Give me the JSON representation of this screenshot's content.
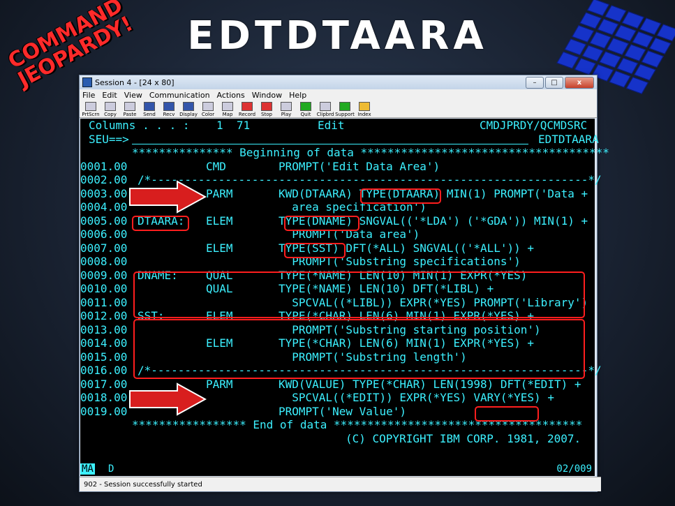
{
  "slide": {
    "title": "EDTDTAARA",
    "logo_left": "COMMAND JEOPARDY!"
  },
  "window": {
    "title": "Session 4 - [24 x 80]",
    "controls": [
      "–",
      "□",
      "x"
    ],
    "menu": [
      "File",
      "Edit",
      "View",
      "Communication",
      "Actions",
      "Window",
      "Help"
    ],
    "toolbar": [
      "PrtScrn",
      "Copy",
      "Paste",
      "Send",
      "Recv",
      "Display",
      "Color",
      "Map",
      "Record",
      "Stop",
      "Play",
      "Quit",
      "Clipbrd",
      "Support",
      "Index"
    ],
    "status": "902 - Session successfully started"
  },
  "terminal": {
    "header1_left": "Columns . . . :    1  71",
    "header1_mid": "Edit",
    "header1_right": "CMDJPRDY/QCMDSRC",
    "header2_left": "SEU==>",
    "header2_right": "EDTDTAARA",
    "begin": "*************** Beginning of data *************************************",
    "lines": [
      {
        "seq": "0001.00",
        "label": "",
        "type": "CMD",
        "text": "PROMPT('Edit Data Area')"
      },
      {
        "seq": "0002.00",
        "label": "",
        "type": "",
        "text": "/*-----------------------------------------------------------------*/",
        "full": true
      },
      {
        "seq": "0003.00",
        "label": "",
        "type": "PARM",
        "text": "KWD(DTAARA) TYPE(DTAARA) MIN(1) PROMPT('Data +"
      },
      {
        "seq": "0004.00",
        "label": "",
        "type": "",
        "text": "  area specification')"
      },
      {
        "seq": "0005.00",
        "label": "DTAARA:",
        "type": "ELEM",
        "text": "TYPE(DNAME) SNGVAL(('*LDA') ('*GDA')) MIN(1) +"
      },
      {
        "seq": "0006.00",
        "label": "",
        "type": "",
        "text": "  PROMPT('Data area')"
      },
      {
        "seq": "0007.00",
        "label": "",
        "type": "ELEM",
        "text": "TYPE(SST) DFT(*ALL) SNGVAL(('*ALL')) +"
      },
      {
        "seq": "0008.00",
        "label": "",
        "type": "",
        "text": "  PROMPT('Substring specifications')"
      },
      {
        "seq": "0009.00",
        "label": "DNAME:",
        "type": "QUAL",
        "text": "TYPE(*NAME) LEN(10) MIN(1) EXPR(*YES)"
      },
      {
        "seq": "0010.00",
        "label": "",
        "type": "QUAL",
        "text": "TYPE(*NAME) LEN(10) DFT(*LIBL) +"
      },
      {
        "seq": "0011.00",
        "label": "",
        "type": "",
        "text": "  SPCVAL((*LIBL)) EXPR(*YES) PROMPT('Library')"
      },
      {
        "seq": "0012.00",
        "label": "SST:",
        "type": "ELEM",
        "text": "TYPE(*CHAR) LEN(6) MIN(1) EXPR(*YES) +"
      },
      {
        "seq": "0013.00",
        "label": "",
        "type": "",
        "text": "  PROMPT('Substring starting position')"
      },
      {
        "seq": "0014.00",
        "label": "",
        "type": "ELEM",
        "text": "TYPE(*CHAR) LEN(6) MIN(1) EXPR(*YES) +"
      },
      {
        "seq": "0015.00",
        "label": "",
        "type": "",
        "text": "  PROMPT('Substring length')"
      },
      {
        "seq": "0016.00",
        "label": "",
        "type": "",
        "text": "/*-----------------------------------------------------------------*/",
        "full": true
      },
      {
        "seq": "0017.00",
        "label": "",
        "type": "PARM",
        "text": "KWD(VALUE) TYPE(*CHAR) LEN(1998) DFT(*EDIT) +"
      },
      {
        "seq": "0018.00",
        "label": "",
        "type": "",
        "text": "  SPCVAL((*EDIT)) EXPR(*YES) VARY(*YES) +"
      },
      {
        "seq": "0019.00",
        "label": "",
        "type": "",
        "text": "PROMPT('New Value')"
      }
    ],
    "end": "***************** End of data *************************************",
    "copyright": "(C) COPYRIGHT IBM CORP. 1981, 2007.",
    "oia_left": "MA",
    "oia_d": "D",
    "oia_right": "02/009"
  },
  "colors": {
    "terminal_text": "#3cf0ff",
    "highlight": "#ff1e1e"
  }
}
